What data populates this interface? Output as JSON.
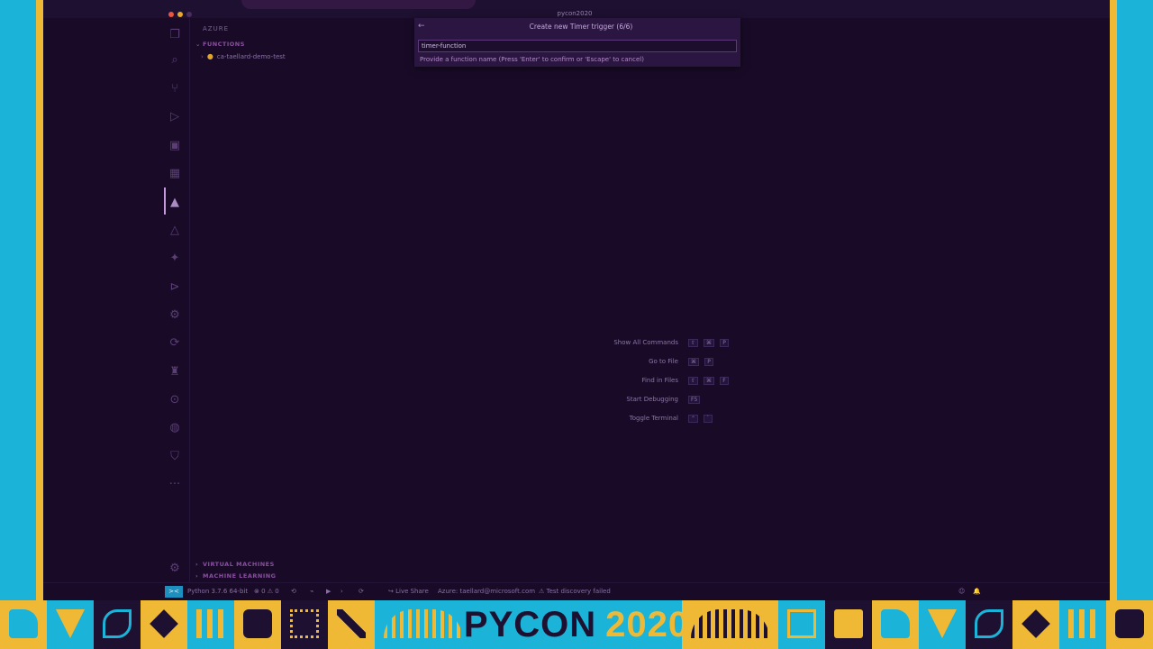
{
  "window": {
    "title": "pycon2020"
  },
  "activity_bar": {
    "icons": [
      "explorer-icon",
      "search-icon",
      "source-control-icon",
      "run-debug-icon",
      "extensions-icon",
      "remote-explorer-icon",
      "azure-icon",
      "azure-alt-icon",
      "cloud-icon",
      "play-circle-icon",
      "settings-gear-icon",
      "git-fork-icon",
      "docker-icon",
      "live-share-icon",
      "globe-icon",
      "shield-icon",
      "ellipsis-icon"
    ],
    "active_index": 6
  },
  "sidebar": {
    "title": "AZURE",
    "functions_section": "FUNCTIONS",
    "function_app": "ca-taellard-demo-test",
    "vm_section": "VIRTUAL MACHINES",
    "ml_section": "MACHINE LEARNING"
  },
  "quick_pick": {
    "title": "Create new Timer trigger (6/6)",
    "input_value": "timer-function",
    "message": "Provide a function name (Press 'Enter' to confirm or 'Escape' to cancel)"
  },
  "shortcuts": [
    {
      "label": "Show All Commands",
      "keys": [
        "⇧",
        "⌘",
        "P"
      ]
    },
    {
      "label": "Go to File",
      "keys": [
        "⌘",
        "P"
      ]
    },
    {
      "label": "Find in Files",
      "keys": [
        "⇧",
        "⌘",
        "F"
      ]
    },
    {
      "label": "Start Debugging",
      "keys": [
        "F5"
      ]
    },
    {
      "label": "Toggle Terminal",
      "keys": [
        "⌃",
        "`"
      ]
    }
  ],
  "status_bar": {
    "remote": "><",
    "python": "Python 3.7.6 64-bit",
    "problems": "⊗ 0 ⚠ 0",
    "live_share": "Live Share",
    "account": "Azure: taellard@microsoft.com",
    "test_status": "⚠ Test discovery failed",
    "feedback": "☺",
    "bell": "🔔"
  },
  "banner": {
    "word": "PYCON",
    "year": "2020",
    "colors": {
      "purple": "#1e1030",
      "blue": "#1bb4d8",
      "gold": "#f0b935"
    }
  }
}
